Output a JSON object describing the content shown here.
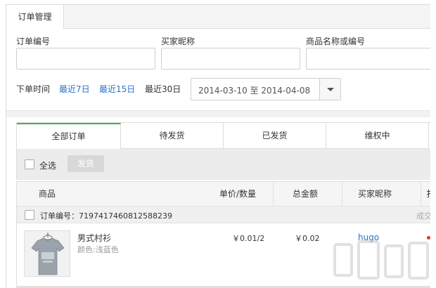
{
  "page_tab": {
    "label": "订单管理"
  },
  "filters": {
    "order_no_label": "订单编号",
    "buyer_nick_label": "买家昵称",
    "product_label": "商品名称或编号",
    "order_no_value": "",
    "buyer_nick_value": "",
    "product_value": ""
  },
  "date_filter": {
    "label": "下单时间",
    "last7": "最近7日",
    "last15": "最近15日",
    "last30": "最近30日",
    "range_text": "2014-03-10 至 2014-04-08"
  },
  "status_tabs": [
    "全部订单",
    "待发货",
    "已发货",
    "维权中"
  ],
  "actions": {
    "select_all": "全选",
    "ship": "发货"
  },
  "table": {
    "headers": {
      "product": "商品",
      "price_qty": "单价/数量",
      "total": "总金额",
      "buyer": "买家昵称",
      "more": "扌"
    }
  },
  "order": {
    "order_no": "订单编号：7197417460812588239",
    "status_cut": "成交",
    "product_name": "男式村衫",
    "product_spec": "颜色:浅蓝色",
    "price_qty": "￥0.01/2",
    "total": "￥0.02",
    "buyer": "hugo"
  },
  "colors": {
    "accent_green": "#4bb04f",
    "link_blue": "#2a72c8",
    "status_red": "#d83b2b"
  }
}
